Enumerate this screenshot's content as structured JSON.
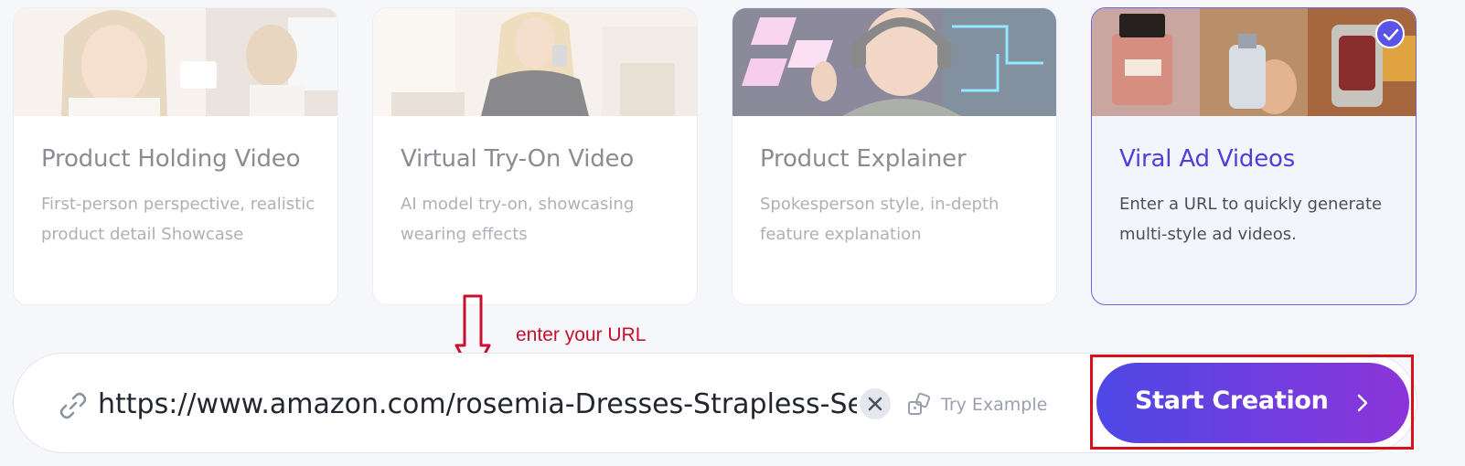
{
  "cards": [
    {
      "title": "Product Holding Video",
      "description": "First-person perspective, realistic product detail Showcase",
      "thumbnail": "woman-holding-cream-jar",
      "selected": false
    },
    {
      "title": "Virtual Try-On Video",
      "description": "AI model try-on, showcasing wearing effects",
      "thumbnail": "woman-mirror-selfie-dress",
      "selected": false
    },
    {
      "title": "Product Explainer",
      "description": "Spokesperson style, in-depth feature explanation",
      "thumbnail": "streamer-with-headset",
      "selected": false
    },
    {
      "title": "Viral Ad Videos",
      "description": "Enter a URL to quickly generate multi-style ad videos.",
      "thumbnail": "perfume-and-product-collage",
      "selected": true,
      "badge_icon": "check-icon"
    }
  ],
  "annotation": {
    "text": "enter your URL",
    "color": "#c8102e",
    "arrow_icon": "down-arrow-icon"
  },
  "url_bar": {
    "icon": "link-icon",
    "value": "https://www.amazon.com/rosemia-Dresses-Strapless-Sexy-Bodycon",
    "clear_icon": "close-icon",
    "try_example_label": "Try Example",
    "try_example_icon": "dice-icon"
  },
  "start_button": {
    "label": "Start Creation",
    "icon": "chevron-right-icon",
    "gradient": [
      "#4e48e6",
      "#8c34d9"
    ],
    "highlight_color": "#d8101c"
  },
  "colors": {
    "accent": "#5b52e8",
    "selected_title": "#4f3fd6",
    "background": "#f6f7fb"
  }
}
